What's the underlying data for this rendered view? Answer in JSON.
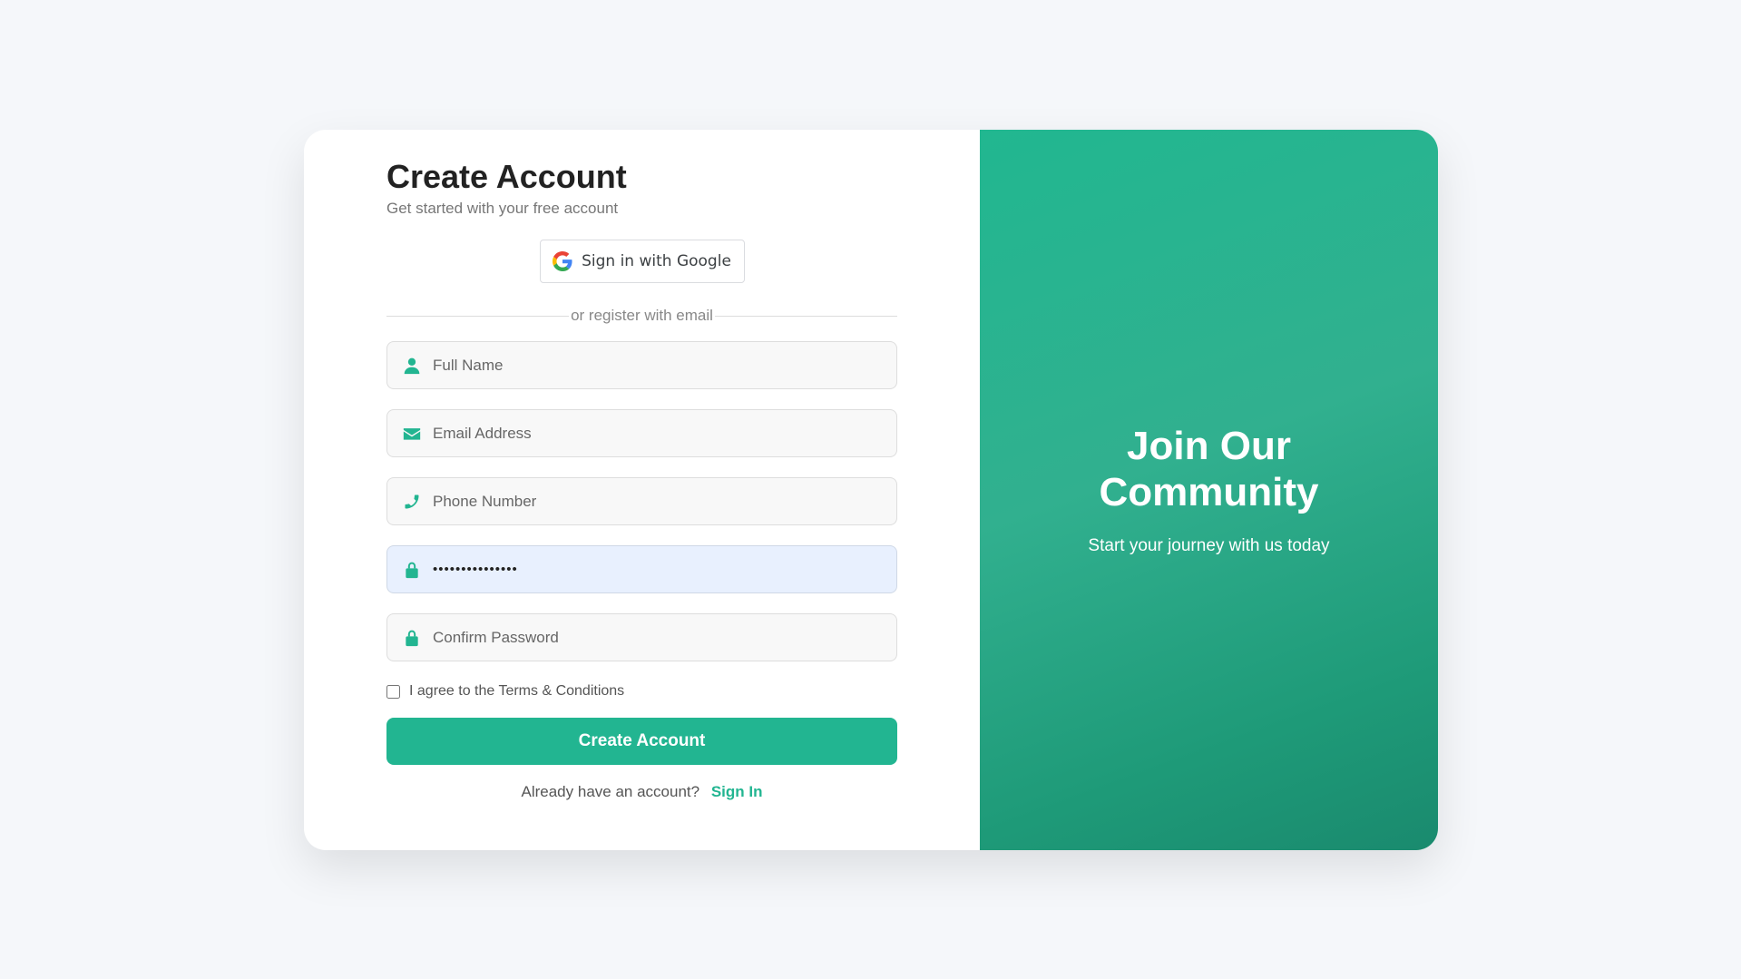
{
  "form": {
    "title": "Create Account",
    "subtitle": "Get started with your free account",
    "google_label": "Sign in with Google",
    "divider_text": "or register with email",
    "fields": {
      "full_name": {
        "placeholder": "Full Name",
        "icon": "user-icon"
      },
      "email": {
        "placeholder": "Email Address",
        "icon": "envelope-icon"
      },
      "phone": {
        "placeholder": "Phone Number",
        "icon": "phone-icon"
      },
      "password": {
        "value": "•••••••••••••••",
        "icon": "lock-icon"
      },
      "confirm_password": {
        "placeholder": "Confirm Password",
        "icon": "lock-icon"
      }
    },
    "terms_label": "I agree to the Terms & Conditions",
    "submit_label": "Create Account",
    "signin_prompt": "Already have an account?",
    "signin_link": "Sign In"
  },
  "panel": {
    "title_line1": "Join Our",
    "title_line2": "Community",
    "subtitle": "Start your journey with us today"
  },
  "colors": {
    "accent": "#22b591",
    "background": "#f5f7fa",
    "panel_gradient_start": "#21b790",
    "panel_gradient_end": "#1a8a6e"
  }
}
